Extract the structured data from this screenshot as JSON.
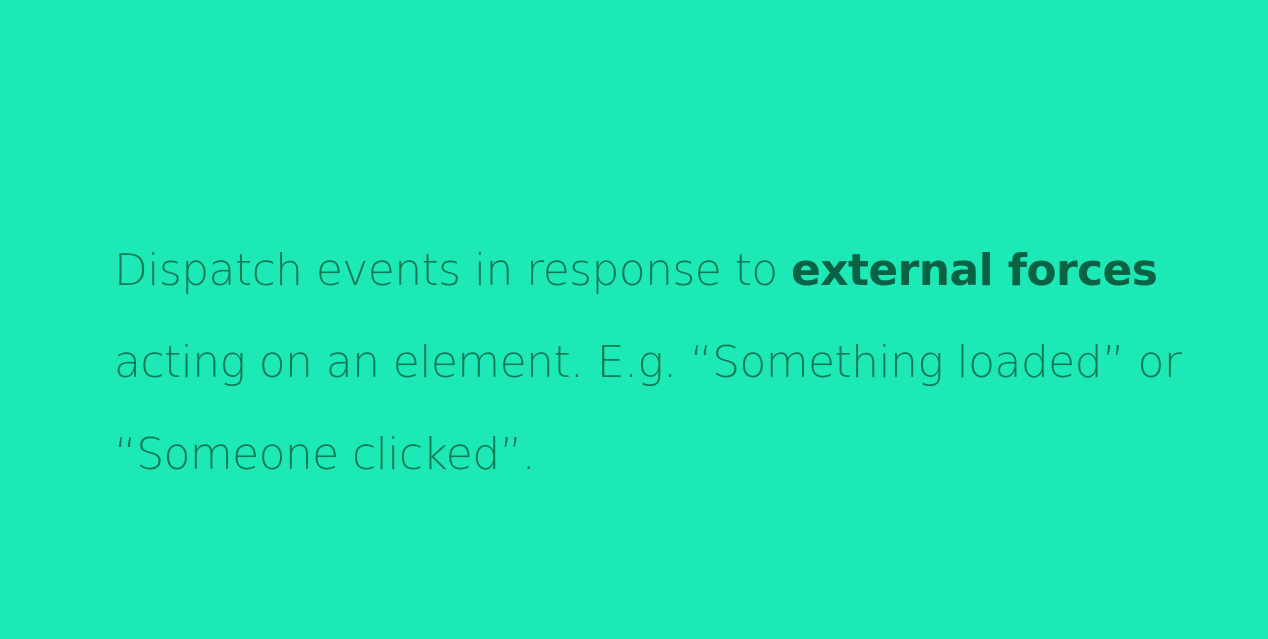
{
  "slide": {
    "background_color": "#1de9b6",
    "text_color": "#0e7a55",
    "emphasis_color": "#0a6245",
    "statement": {
      "line1_regular": "Dispatch events in response to ",
      "line1_bold": "external forces",
      "line2": "acting on an element. E.g. “Something loaded” or",
      "line3": "“Someone clicked”."
    }
  }
}
